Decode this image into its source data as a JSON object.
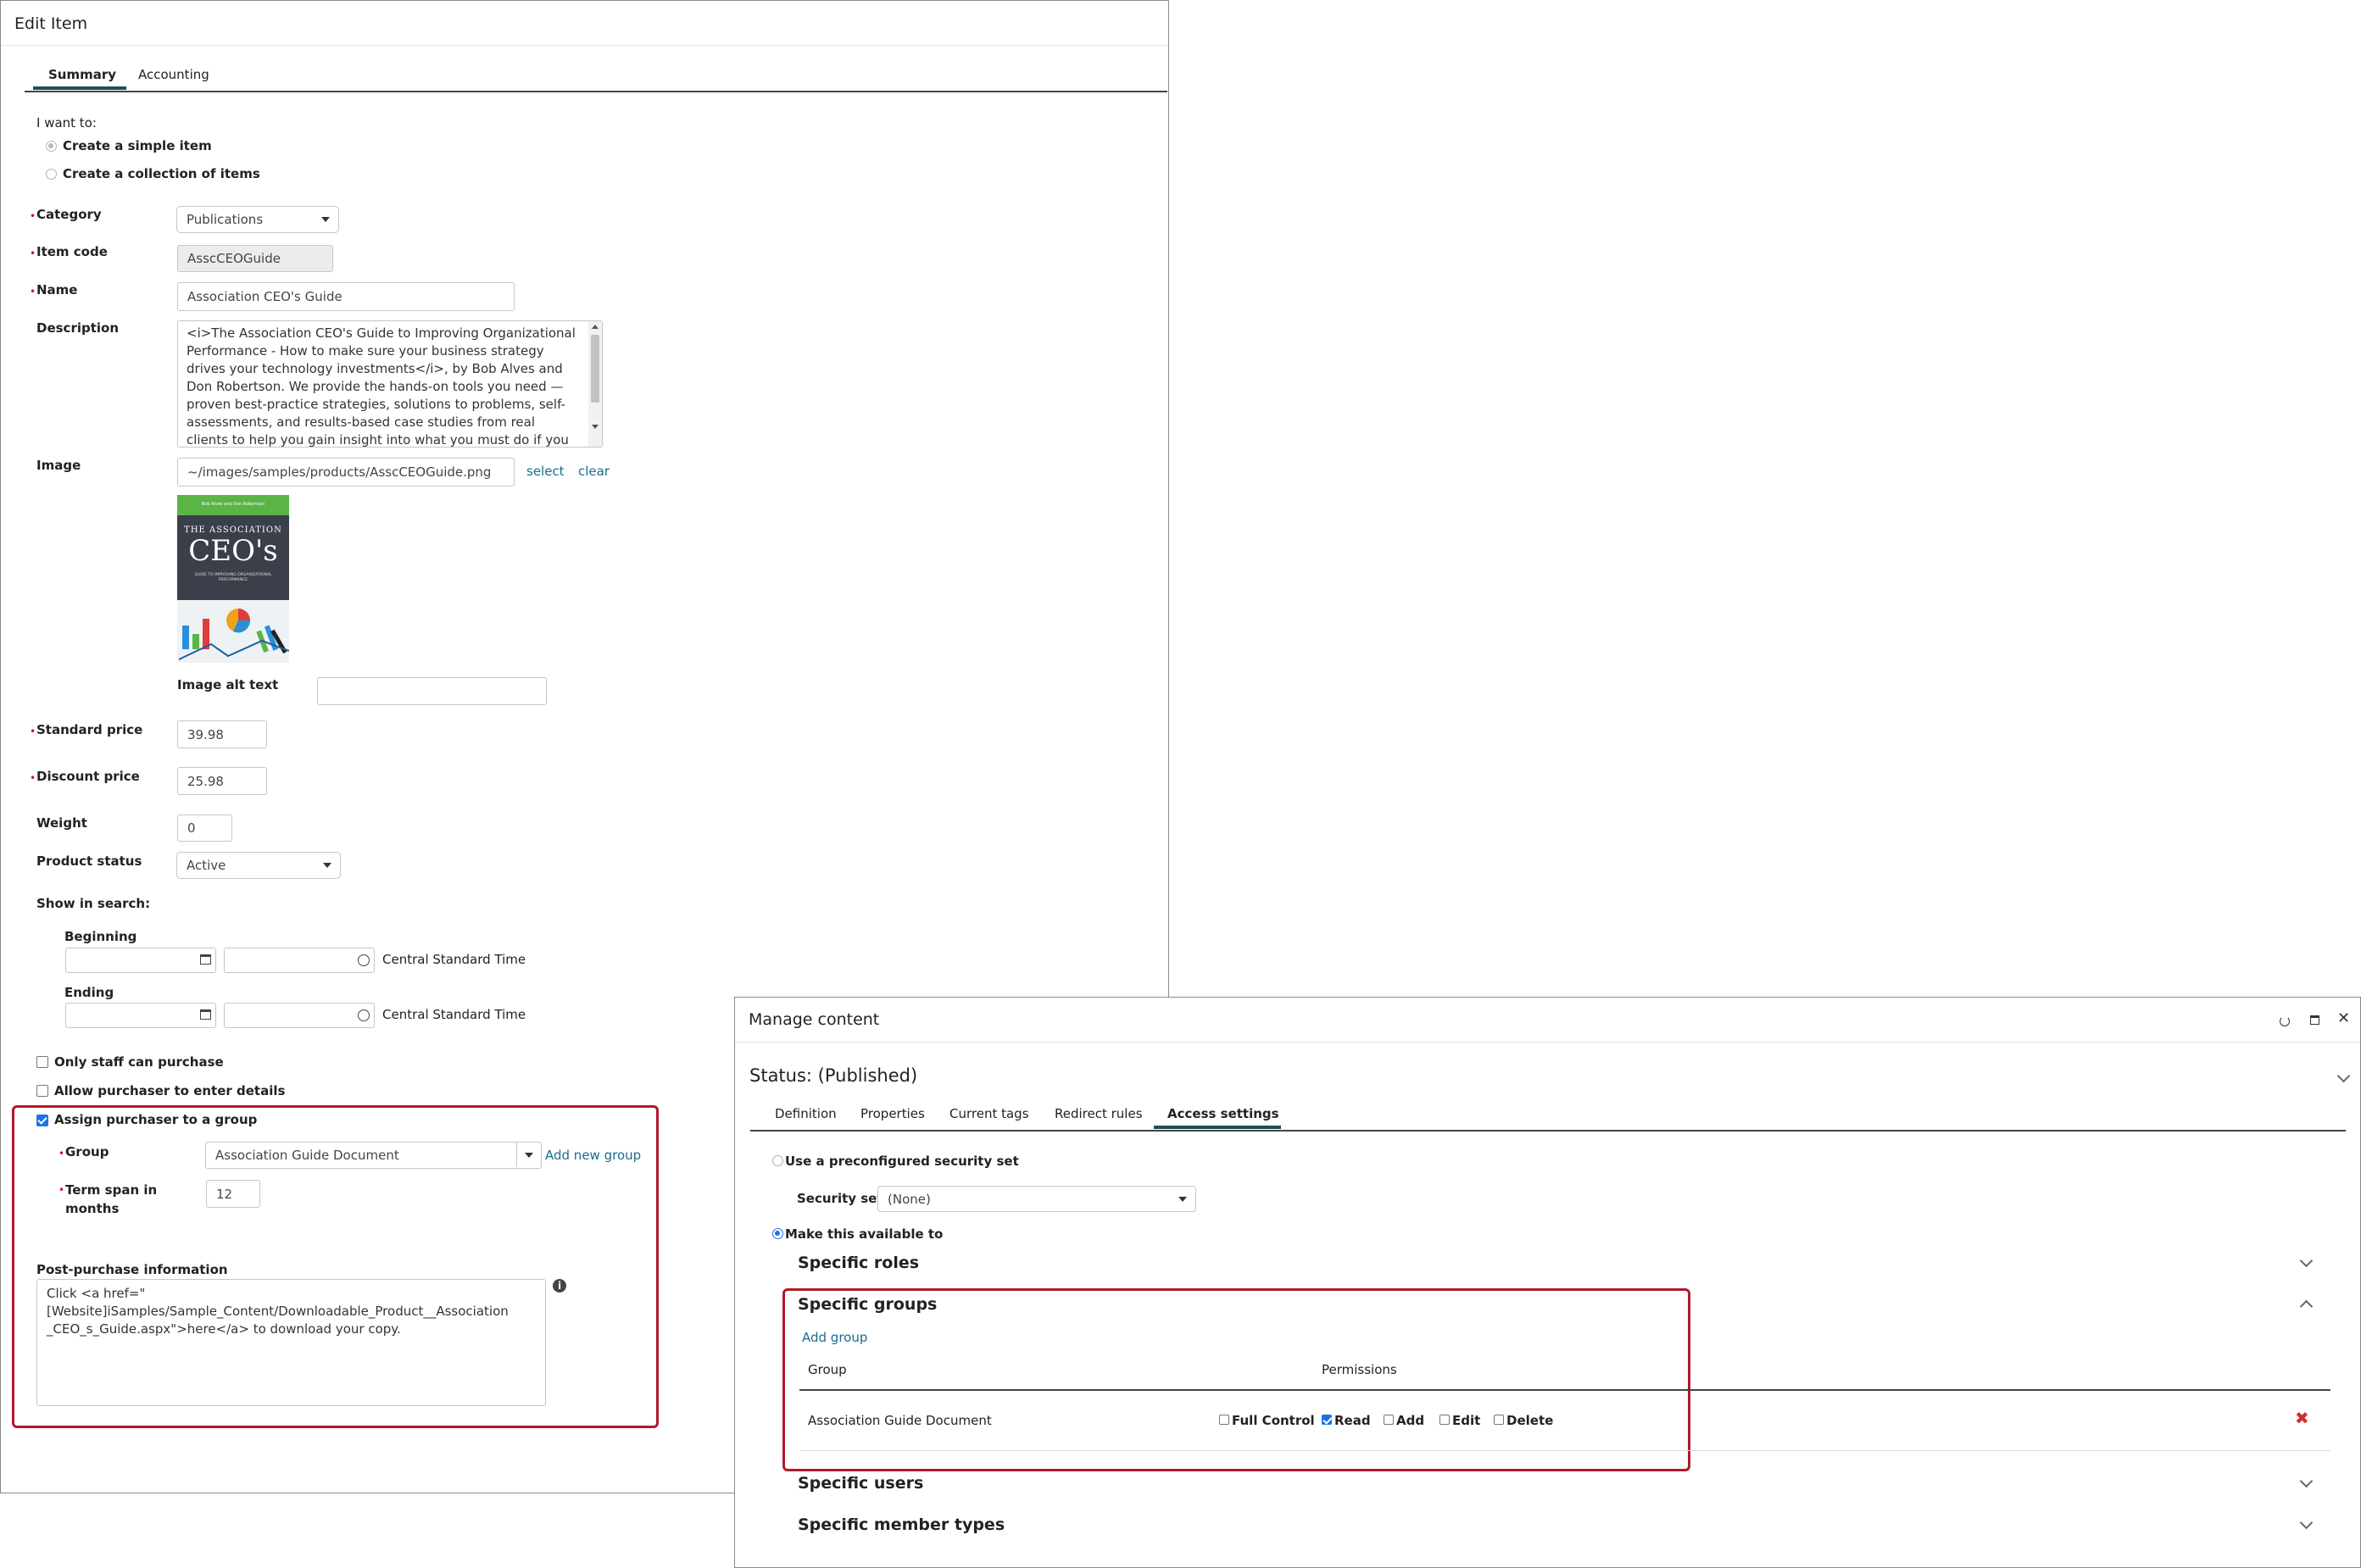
{
  "edit_item": {
    "title": "Edit Item",
    "tabs": [
      "Summary",
      "Accounting"
    ],
    "i_want_to": "I want to:",
    "options": [
      "Create a simple item",
      "Create a collection of items"
    ],
    "category_label": "Category",
    "category_value": "Publications",
    "item_code_label": "Item code",
    "item_code_value": "AsscCEOGuide",
    "name_label": "Name",
    "name_value": "Association CEO's Guide",
    "description_label": "Description",
    "description_lines": [
      "<i>The Association CEO's Guide to Improving Organizational",
      "Performance - How to make sure your business strategy",
      "drives your technology investments</i>, by Bob Alves and",
      "Don Robertson. We provide the hands-on tools you need —",
      "proven best-practice strategies, solutions to problems, self-",
      "assessments, and results-based case studies from real",
      "clients to help you gain insight into what you must do if you"
    ],
    "image_label": "Image",
    "image_value": "~/images/samples/products/AsscCEOGuide.png",
    "select_link": "select",
    "clear_link": "clear",
    "cover": {
      "top_text": "Bob Alves and Don Robertson",
      "the_association": "THE ASSOCIATION",
      "ceos": "CEO's",
      "subtitle": "GUIDE TO IMPROVING ORGANIZATIONAL PERFORMANCE"
    },
    "alt_text_label": "Image alt text",
    "standard_price_label": "Standard price",
    "standard_price_value": "39.98",
    "discount_price_label": "Discount price",
    "discount_price_value": "25.98",
    "weight_label": "Weight",
    "weight_value": "0",
    "product_status_label": "Product status",
    "product_status_value": "Active",
    "show_in_search_label": "Show in search:",
    "beginning_label": "Beginning",
    "ending_label": "Ending",
    "timezone": "Central Standard Time",
    "only_staff_label": "Only staff can purchase",
    "allow_details_label": "Allow purchaser to enter details",
    "assign_group_label": "Assign purchaser to a group",
    "group_label": "Group",
    "group_value": "Association Guide Document",
    "add_new_group": "Add new group",
    "term_span_label_1": "Term span in",
    "term_span_label_2": "months",
    "term_span_value": "12",
    "post_purchase_label": "Post-purchase information",
    "post_purchase_lines": [
      "Click <a href=\"",
      "[Website]iSamples/Sample_Content/Downloadable_Product__Association",
      "_CEO_s_Guide.aspx\">here</a> to download your copy."
    ]
  },
  "manage_content": {
    "title": "Manage content",
    "status": "Status: (Published)",
    "tabs": [
      "Definition",
      "Properties",
      "Current tags",
      "Redirect rules",
      "Access settings"
    ],
    "preconfigured_label": "Use a preconfigured security set",
    "security_set_label": "Security set",
    "security_set_value": "(None)",
    "make_available_label": "Make this available to",
    "specific_roles": "Specific roles",
    "specific_groups": "Specific groups",
    "add_group": "Add group",
    "group_col": "Group",
    "permissions_col": "Permissions",
    "row_group": "Association Guide Document",
    "permissions": [
      "Full Control",
      "Read",
      "Add",
      "Edit",
      "Delete"
    ],
    "specific_users": "Specific users",
    "specific_member_types": "Specific member types"
  }
}
